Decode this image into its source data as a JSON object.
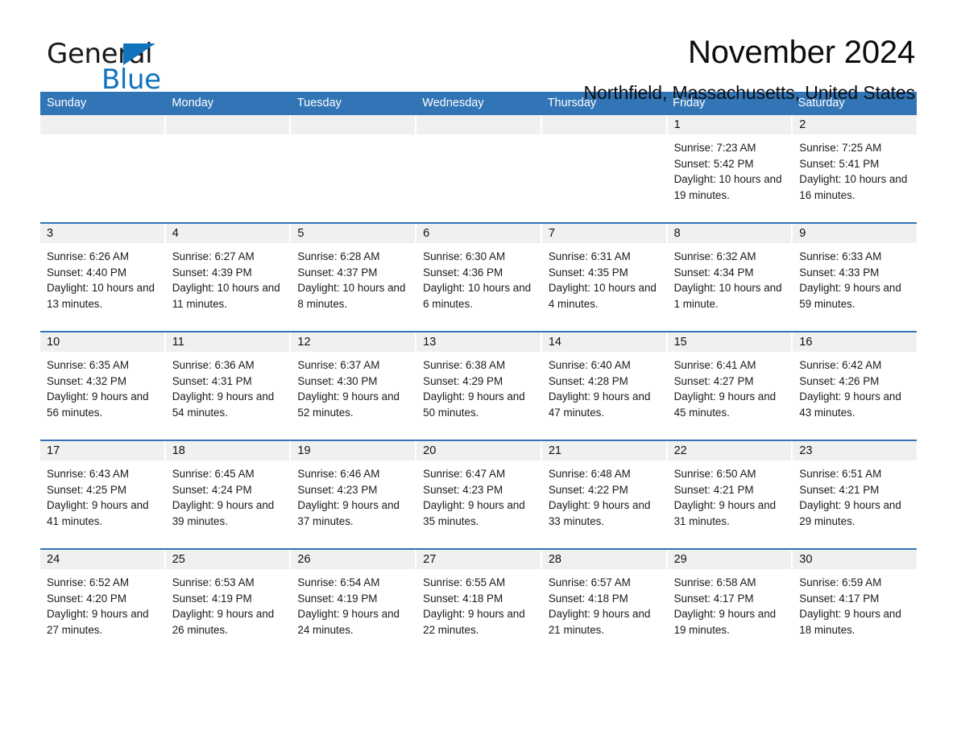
{
  "logo": {
    "word1": "General",
    "word2": "Blue",
    "triangle_color": "#1273bd"
  },
  "header": {
    "title": "November 2024",
    "subtitle": "Northfield, Massachusetts, United States"
  },
  "colors": {
    "header_blue": "#3275b6",
    "daynum_band": "#f0f0f0",
    "text": "#1a1a1a"
  },
  "weekdays": [
    "Sunday",
    "Monday",
    "Tuesday",
    "Wednesday",
    "Thursday",
    "Friday",
    "Saturday"
  ],
  "weeks": [
    [
      {
        "day": "",
        "info": ""
      },
      {
        "day": "",
        "info": ""
      },
      {
        "day": "",
        "info": ""
      },
      {
        "day": "",
        "info": ""
      },
      {
        "day": "",
        "info": ""
      },
      {
        "day": "1",
        "info": "Sunrise: 7:23 AM\nSunset: 5:42 PM\nDaylight: 10 hours and 19 minutes."
      },
      {
        "day": "2",
        "info": "Sunrise: 7:25 AM\nSunset: 5:41 PM\nDaylight: 10 hours and 16 minutes."
      }
    ],
    [
      {
        "day": "3",
        "info": "Sunrise: 6:26 AM\nSunset: 4:40 PM\nDaylight: 10 hours and 13 minutes."
      },
      {
        "day": "4",
        "info": "Sunrise: 6:27 AM\nSunset: 4:39 PM\nDaylight: 10 hours and 11 minutes."
      },
      {
        "day": "5",
        "info": "Sunrise: 6:28 AM\nSunset: 4:37 PM\nDaylight: 10 hours and 8 minutes."
      },
      {
        "day": "6",
        "info": "Sunrise: 6:30 AM\nSunset: 4:36 PM\nDaylight: 10 hours and 6 minutes."
      },
      {
        "day": "7",
        "info": "Sunrise: 6:31 AM\nSunset: 4:35 PM\nDaylight: 10 hours and 4 minutes."
      },
      {
        "day": "8",
        "info": "Sunrise: 6:32 AM\nSunset: 4:34 PM\nDaylight: 10 hours and 1 minute."
      },
      {
        "day": "9",
        "info": "Sunrise: 6:33 AM\nSunset: 4:33 PM\nDaylight: 9 hours and 59 minutes."
      }
    ],
    [
      {
        "day": "10",
        "info": "Sunrise: 6:35 AM\nSunset: 4:32 PM\nDaylight: 9 hours and 56 minutes."
      },
      {
        "day": "11",
        "info": "Sunrise: 6:36 AM\nSunset: 4:31 PM\nDaylight: 9 hours and 54 minutes."
      },
      {
        "day": "12",
        "info": "Sunrise: 6:37 AM\nSunset: 4:30 PM\nDaylight: 9 hours and 52 minutes."
      },
      {
        "day": "13",
        "info": "Sunrise: 6:38 AM\nSunset: 4:29 PM\nDaylight: 9 hours and 50 minutes."
      },
      {
        "day": "14",
        "info": "Sunrise: 6:40 AM\nSunset: 4:28 PM\nDaylight: 9 hours and 47 minutes."
      },
      {
        "day": "15",
        "info": "Sunrise: 6:41 AM\nSunset: 4:27 PM\nDaylight: 9 hours and 45 minutes."
      },
      {
        "day": "16",
        "info": "Sunrise: 6:42 AM\nSunset: 4:26 PM\nDaylight: 9 hours and 43 minutes."
      }
    ],
    [
      {
        "day": "17",
        "info": "Sunrise: 6:43 AM\nSunset: 4:25 PM\nDaylight: 9 hours and 41 minutes."
      },
      {
        "day": "18",
        "info": "Sunrise: 6:45 AM\nSunset: 4:24 PM\nDaylight: 9 hours and 39 minutes."
      },
      {
        "day": "19",
        "info": "Sunrise: 6:46 AM\nSunset: 4:23 PM\nDaylight: 9 hours and 37 minutes."
      },
      {
        "day": "20",
        "info": "Sunrise: 6:47 AM\nSunset: 4:23 PM\nDaylight: 9 hours and 35 minutes."
      },
      {
        "day": "21",
        "info": "Sunrise: 6:48 AM\nSunset: 4:22 PM\nDaylight: 9 hours and 33 minutes."
      },
      {
        "day": "22",
        "info": "Sunrise: 6:50 AM\nSunset: 4:21 PM\nDaylight: 9 hours and 31 minutes."
      },
      {
        "day": "23",
        "info": "Sunrise: 6:51 AM\nSunset: 4:21 PM\nDaylight: 9 hours and 29 minutes."
      }
    ],
    [
      {
        "day": "24",
        "info": "Sunrise: 6:52 AM\nSunset: 4:20 PM\nDaylight: 9 hours and 27 minutes."
      },
      {
        "day": "25",
        "info": "Sunrise: 6:53 AM\nSunset: 4:19 PM\nDaylight: 9 hours and 26 minutes."
      },
      {
        "day": "26",
        "info": "Sunrise: 6:54 AM\nSunset: 4:19 PM\nDaylight: 9 hours and 24 minutes."
      },
      {
        "day": "27",
        "info": "Sunrise: 6:55 AM\nSunset: 4:18 PM\nDaylight: 9 hours and 22 minutes."
      },
      {
        "day": "28",
        "info": "Sunrise: 6:57 AM\nSunset: 4:18 PM\nDaylight: 9 hours and 21 minutes."
      },
      {
        "day": "29",
        "info": "Sunrise: 6:58 AM\nSunset: 4:17 PM\nDaylight: 9 hours and 19 minutes."
      },
      {
        "day": "30",
        "info": "Sunrise: 6:59 AM\nSunset: 4:17 PM\nDaylight: 9 hours and 18 minutes."
      }
    ]
  ]
}
